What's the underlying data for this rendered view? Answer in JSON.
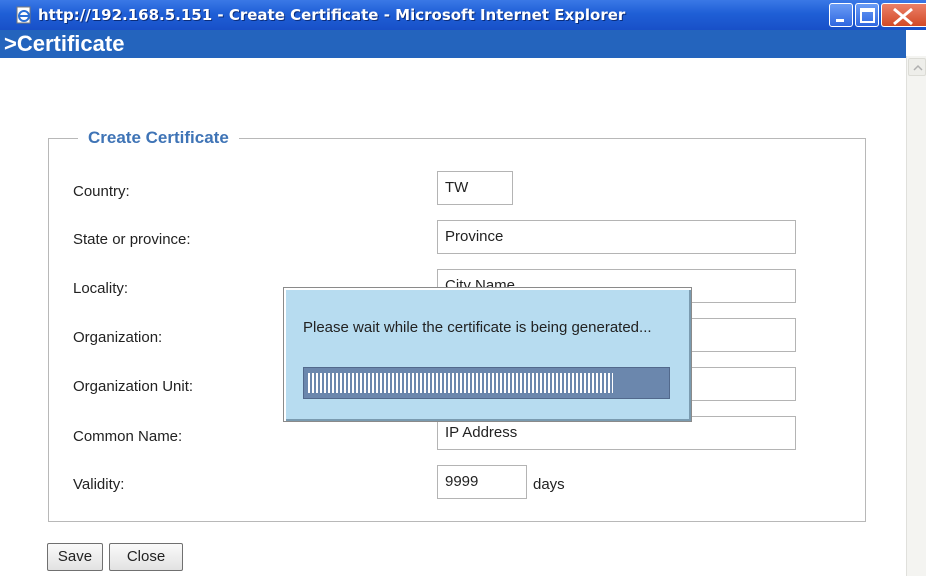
{
  "window": {
    "title": "http://192.168.5.151 - Create Certificate - Microsoft Internet Explorer",
    "controls": [
      "minimize-icon",
      "maximize-icon",
      "close-icon"
    ]
  },
  "header": {
    "title": ">Certificate"
  },
  "form": {
    "legend": "Create Certificate",
    "fields": [
      {
        "label": "Country:",
        "value": "TW"
      },
      {
        "label": "State or province:",
        "value": "Province"
      },
      {
        "label": "Locality:",
        "value": "City Name"
      },
      {
        "label": "Organization:",
        "value": ""
      },
      {
        "label": "Organization Unit:",
        "value": ""
      },
      {
        "label": "Common Name:",
        "value": "IP Address"
      },
      {
        "label": "Validity:",
        "value": "9999"
      }
    ],
    "validity_unit": "days"
  },
  "buttons": {
    "save": "Save",
    "close": "Close"
  },
  "popup": {
    "message": "Please wait while the certificate is being generated...",
    "progress_fraction": 0.85
  },
  "colors": {
    "titlebar": "#1f5fd6",
    "header": "#2464bd",
    "legend": "#3f74b6",
    "popup_bg": "#b7dcf0",
    "progress_bg": "#6b87ad"
  }
}
